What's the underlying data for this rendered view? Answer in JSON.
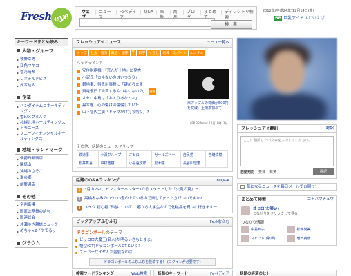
{
  "header": {
    "logo_text": "Fresh",
    "logo_eye": "eye",
    "search_tabs": [
      "ウェブ",
      "ニュース",
      "Feペディア",
      "Q&A",
      "画像",
      "商品",
      "ブログ",
      "まとめて",
      "ディレクトリ検索"
    ],
    "search_placeholder": "",
    "search_button": "検 索",
    "date": "2012年(平成24年)12月14日(金)",
    "brand_mark": "BB",
    "brand_text": "巨乳アイドルといえば"
  },
  "left": {
    "heading": "キーワードまとめ読み",
    "sections": [
      {
        "title": "人物・グループ",
        "items": [
          "枝野幸男",
          "江角マキコ",
          "菅乃晴希",
          "レオナルドビス",
          "茂木廷人"
        ]
      },
      {
        "title": "企業",
        "items": [
          "バンダイナムコホールディングス",
          "雪印メグミルク",
          "札幌北洋ホールディングス",
          "アモニーズ",
          "ソニーフィナンシャルホールディングス"
        ]
      },
      {
        "title": "地域・ランドマーク",
        "items": [
          "伊勢丹新宿店",
          "関係山",
          "沖縄のさそこ",
          "湯の郷",
          "飯野通店"
        ]
      },
      {
        "title": "その他",
        "items": [
          "全判衛模",
          "国家公務員の給与",
          "国連総会",
          "片瀬ゆき雑誌ニュック",
          "めちゃ×2イケてるッ！"
        ]
      },
      {
        "title": "グラウム",
        "items": []
      }
    ]
  },
  "news": {
    "title": "フレッシュアイニュース",
    "more": "ニュース一覧へ",
    "categories": [
      "トップ",
      "社会",
      "経済",
      "政治",
      "国際",
      "IT",
      "科学",
      "くらし",
      "地域",
      "スポーツ",
      "エンタメ"
    ],
    "headline_label": "ヘッドライン?",
    "headlines": [
      {
        "text": "安住財務相、「死んだ土地」に発言",
        "tag": ""
      },
      {
        "text": "小沢氏「カネないのはいつかり」",
        "tag": ""
      },
      {
        "text": "銀地事、得意射事務に「辞めろまえ」",
        "tag": ""
      },
      {
        "text": "東電復旧「自首するやつもいないの」",
        "tag": "速報"
      },
      {
        "text": "オセロ中島は「お入りあなとか」",
        "tag": ""
      },
      {
        "text": "黒木瞳、心の傷は深傷傍していた",
        "tag": ""
      },
      {
        "text": "山下智久主演「ドラマがけ打ち切り」?",
        "tag": ""
      }
    ],
    "feature_text": "米アップルの株価が500円を突破、上場来初めて",
    "feature_credit": "AFP BB News 14日18時13分",
    "clip_label": "その他、話題のニュースクリップ",
    "clips": [
      "鉄道事",
      "小沢グループ",
      "オセロ",
      "ガールズバー",
      "自民党",
      "吉継佑樹",
      "松井秀喜",
      "中村浩樹",
      "小島遠次郎",
      "黒木瞳",
      "長谷川理恵",
      ""
    ]
  },
  "qa": {
    "title": "話題のQ&Aランキング",
    "more": "FeQ&A",
    "items": [
      "3月のPS2、モンスターハンター1からスタートした「火竜の翼」ー",
      "高橋みなみのロクロ3走の上ているので楽してまった方がいいですか?",
      "メイク 初心者 下地について！ 春から大学生なので化粧品を買いに行きます一"
    ]
  },
  "pickup": {
    "title": "ピックアップふむふむ",
    "more": "Feふむふむ",
    "subject": "ドラゴンボール",
    "subject_suffix": "のテーマ",
    "items": [
      "ビッコロ大魔王(名人)が明るいさもとまま。",
      "悟空(GT)ドラゴンボールGTという?",
      "スーパーサイヤ人が金髪なのは"
    ],
    "button": "ドラゴンボールのふむふむを投稿する！ (ログインが必要です)"
  },
  "bottom_tabs": [
    {
      "label": "検索ワードランキング",
      "more": "Web検索"
    },
    {
      "label": "話題のキーワード",
      "more": "Feペディア"
    },
    {
      "label": "話題の経済のヒト",
      "more": ""
    }
  ],
  "right": {
    "translate": {
      "title": "フレッシュアイ翻訳",
      "more": "翻訳",
      "placeholder": "ここに翻訳したい文章を入力してください。",
      "options": [
        "自動判別",
        "英日",
        "日英"
      ],
      "button": "翻訳"
    },
    "mail_bar": "気になるニュースを毎日メールでお届け！",
    "matome": {
      "title": "まとめて検索",
      "more": "コトバウチュウ",
      "lead_name": "オセロ(お笑い)",
      "lead_desc": "つながりをクリックして見る",
      "tsunagari_label": "つながり情報",
      "people": [
        "中島知子",
        "松嶋尚美",
        "マヒンド (歌手)",
        "増田英彦"
      ]
    }
  },
  "colors": {
    "accent": "#ff8c00",
    "link": "#1a3e9c",
    "brand": "#1a2e8c",
    "logo_green": "#8ec63f"
  }
}
